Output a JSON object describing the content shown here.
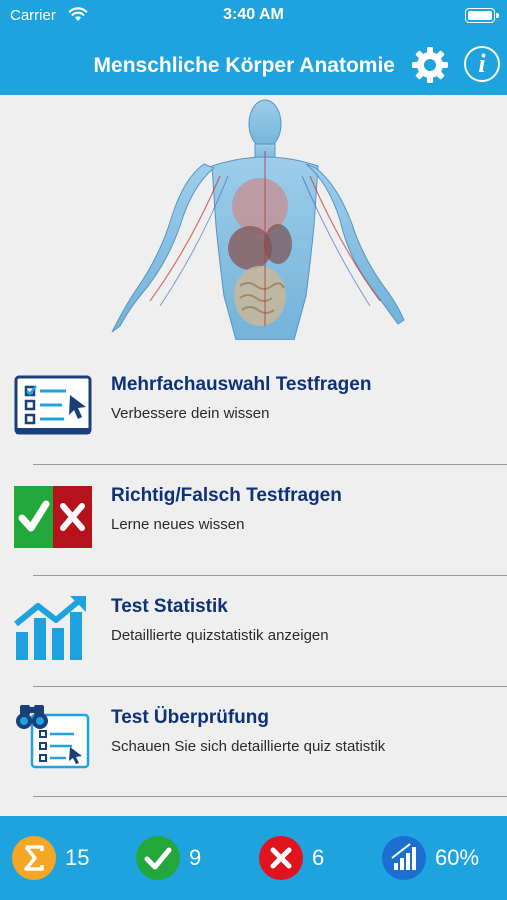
{
  "status_bar": {
    "carrier": "Carrier",
    "time": "3:40 AM"
  },
  "header": {
    "title": "Menschliche Körper Anatomie"
  },
  "menu": [
    {
      "title": "Mehrfachauswahl Testfragen",
      "subtitle": "Verbessere dein wissen",
      "icon": "multiple-choice-icon"
    },
    {
      "title": "Richtig/Falsch Testfragen",
      "subtitle": "Lerne neues wissen",
      "icon": "true-false-icon"
    },
    {
      "title": "Test Statistik",
      "subtitle": "Detaillierte quizstatistik anzeigen",
      "icon": "statistics-chart-icon"
    },
    {
      "title": "Test Überprüfung",
      "subtitle": "Schauen Sie sich detaillierte quiz statistik",
      "icon": "review-binoculars-icon"
    }
  ],
  "stats": {
    "total": "15",
    "correct": "9",
    "wrong": "6",
    "percent": "60%"
  },
  "colors": {
    "brand": "#1fa3de",
    "title_text": "#0d3277",
    "correct": "#22a83a",
    "wrong": "#e0141e",
    "total": "#f5a623"
  }
}
